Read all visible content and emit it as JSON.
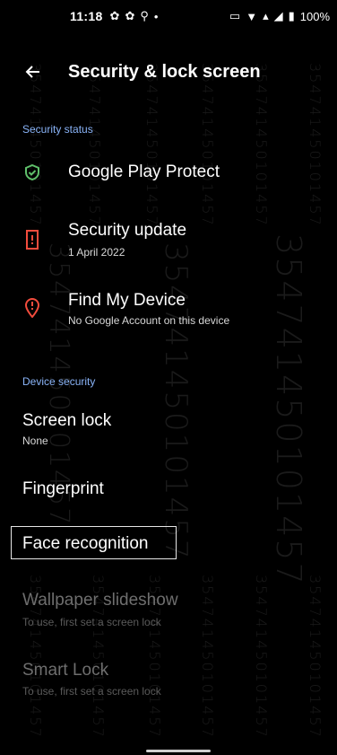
{
  "status_bar": {
    "time": "11:18",
    "battery": "100%"
  },
  "header": {
    "title": "Security & lock screen"
  },
  "watermark": "354741450101457",
  "sections": {
    "security_status": "Security status",
    "device_security": "Device security"
  },
  "items": {
    "play_protect": {
      "title": "Google Play Protect"
    },
    "security_update": {
      "title": "Security update",
      "subtitle": "1 April 2022"
    },
    "find_my_device": {
      "title": "Find My Device",
      "subtitle": "No Google Account on this device"
    },
    "screen_lock": {
      "title": "Screen lock",
      "subtitle": "None"
    },
    "fingerprint": {
      "title": "Fingerprint"
    },
    "face_recognition": {
      "title": "Face recognition"
    },
    "wallpaper_slideshow": {
      "title": "Wallpaper slideshow",
      "subtitle": "To use, first set a screen lock"
    },
    "smart_lock": {
      "title": "Smart Lock",
      "subtitle": "To use, first set a screen lock"
    }
  },
  "colors": {
    "accent": "#8ab4f8",
    "protect_green": "#5fbf6a",
    "alert_red": "#f24c3d"
  },
  "icons": {
    "back": "arrow-left",
    "play_protect": "shield-check",
    "security_update": "phone-alert",
    "find_my_device": "location-alert"
  }
}
